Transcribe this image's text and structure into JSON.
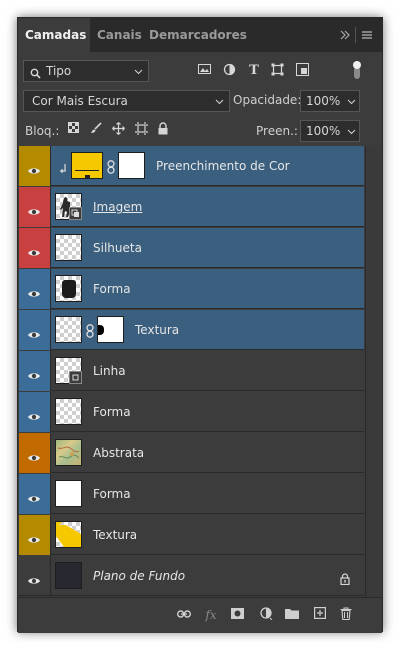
{
  "tabs": [
    {
      "label": "Camadas",
      "active": true
    },
    {
      "label": "Canais",
      "active": false
    },
    {
      "label": "Demarcadores",
      "active": false
    }
  ],
  "tab_icons": [
    "collapse-chevrons-icon",
    "panel-menu-icon"
  ],
  "filter": {
    "label": "Tipo",
    "icons": [
      "image-filter-icon",
      "adjustment-filter-icon",
      "type-filter-icon",
      "shape-filter-icon",
      "smart-object-filter-icon",
      "filter-toggle-icon"
    ]
  },
  "blend": {
    "mode": "Cor Mais Escura",
    "opacity_label": "Opacidade:",
    "opacity_value": "100%"
  },
  "lock": {
    "label": "Bloq.:",
    "fill_label": "Preen.:",
    "fill_value": "100%",
    "icons": [
      "lock-transparent-icon",
      "lock-brush-icon",
      "lock-move-icon",
      "lock-artboard-icon",
      "lock-all-icon"
    ]
  },
  "layers": [
    {
      "name": "Preenchimento de Cor",
      "tag": "#b48a00",
      "selected": true,
      "thumb": "fill-yellow",
      "mask": true,
      "clipped": true
    },
    {
      "name": "Imagem",
      "tag": "#c94040",
      "selected": true,
      "thumb": "smart-figure",
      "underline": true
    },
    {
      "name": "Silhueta",
      "tag": "#c94040",
      "selected": true,
      "thumb": "checker"
    },
    {
      "name": "Forma",
      "tag": "#3b6d98",
      "selected": true,
      "thumb": "dark-shape"
    },
    {
      "name": "Textura",
      "tag": "#3b6d98",
      "selected": true,
      "thumb": "checker",
      "mask": true
    },
    {
      "name": "Linha",
      "tag": "#3b6d98",
      "selected": false,
      "thumb": "checker-transform"
    },
    {
      "name": "Forma",
      "tag": "#3b6d98",
      "selected": false,
      "thumb": "checker"
    },
    {
      "name": "Abstrata",
      "tag": "#c06a00",
      "selected": false,
      "thumb": "map"
    },
    {
      "name": "Forma",
      "tag": "#3b6d98",
      "selected": false,
      "thumb": "white"
    },
    {
      "name": "Textura",
      "tag": "#b48a00",
      "selected": false,
      "thumb": "yellow-checker"
    },
    {
      "name": "Plano de Fundo",
      "tag": "none",
      "selected": false,
      "thumb": "dark",
      "italic": true,
      "locked": true
    }
  ],
  "footer_icons": [
    "link-layers-icon",
    "fx-icon",
    "add-mask-icon",
    "adjustment-layer-icon",
    "group-folder-icon",
    "new-layer-icon",
    "delete-layer-icon"
  ],
  "footer_fx": "fx"
}
